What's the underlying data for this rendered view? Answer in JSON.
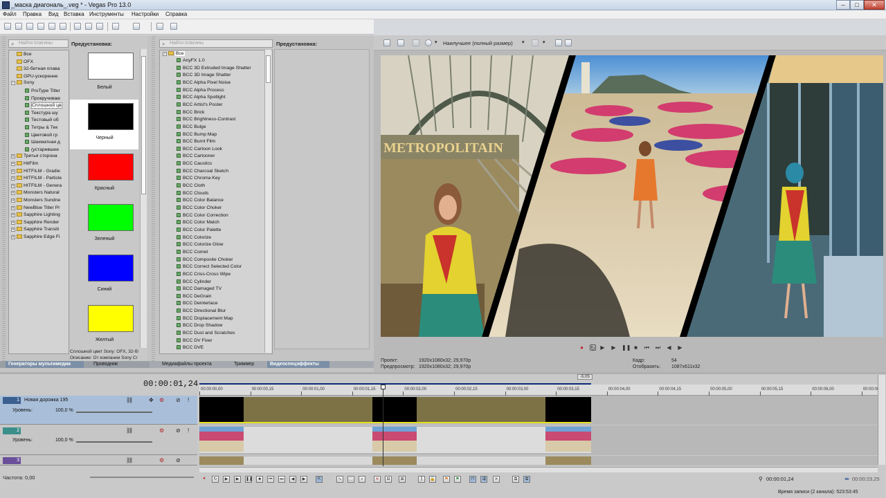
{
  "window": {
    "title": "_маска диагональ_.veg * - Vegas Pro 13.0",
    "min": "–",
    "max": "□",
    "close": "✕"
  },
  "menu": [
    "Файл",
    "Правка",
    "Вид",
    "Вставка",
    "Инструменты",
    "Настройки",
    "Справка"
  ],
  "media_generators": {
    "search_placeholder": "Найти плагины",
    "tree": [
      {
        "label": "Все",
        "level": 0,
        "expand": ""
      },
      {
        "label": "OFX",
        "level": 0,
        "expand": ""
      },
      {
        "label": "32-битная плава",
        "level": 0,
        "expand": ""
      },
      {
        "label": "GPU-ускорение",
        "level": 0,
        "expand": ""
      },
      {
        "label": "Sony",
        "level": 0,
        "expand": "−"
      },
      {
        "label": "ProType Titler",
        "level": 1,
        "expand": ""
      },
      {
        "label": "Прокручиваю",
        "level": 1,
        "expand": ""
      },
      {
        "label": "Сплошной цв",
        "level": 1,
        "expand": "",
        "selected": true
      },
      {
        "label": "Текстура шу",
        "level": 1,
        "expand": ""
      },
      {
        "label": "Тестовый об",
        "level": 1,
        "expand": ""
      },
      {
        "label": "Титры & Тек",
        "level": 1,
        "expand": ""
      },
      {
        "label": "Цветовой гр",
        "level": 1,
        "expand": ""
      },
      {
        "label": "Шахматная д",
        "level": 1,
        "expand": ""
      },
      {
        "label": "(устаревшее",
        "level": 1,
        "expand": ""
      },
      {
        "label": "Третья сторона",
        "level": 0,
        "expand": "+"
      },
      {
        "label": "HitFilm",
        "level": 0,
        "expand": "+"
      },
      {
        "label": "HITFILM - Gradie",
        "level": 0,
        "expand": "+"
      },
      {
        "label": "HITFILM - Particle",
        "level": 0,
        "expand": "+"
      },
      {
        "label": "HITFILM - Genera",
        "level": 0,
        "expand": "+"
      },
      {
        "label": "Monsters Natural",
        "level": 0,
        "expand": "+"
      },
      {
        "label": "Monsters Sundne",
        "level": 0,
        "expand": "+"
      },
      {
        "label": "NewBlue Titler Pr",
        "level": 0,
        "expand": "+"
      },
      {
        "label": "Sapphire Lighting",
        "level": 0,
        "expand": "+"
      },
      {
        "label": "Sapphire Render",
        "level": 0,
        "expand": "+"
      },
      {
        "label": "Sapphire Transiti",
        "level": 0,
        "expand": "+"
      },
      {
        "label": "Sapphire Edge Fi",
        "level": 0,
        "expand": "+"
      }
    ],
    "preset_header": "Предустановка:",
    "presets": [
      {
        "label": "Белый",
        "color": "#ffffff"
      },
      {
        "label": "Черный",
        "color": "#000000"
      },
      {
        "label": "Красный",
        "color": "#ff0000"
      },
      {
        "label": "Зеленый",
        "color": "#00ff00"
      },
      {
        "label": "Синий",
        "color": "#0000ff"
      },
      {
        "label": "Желтый",
        "color": "#ffff00"
      }
    ],
    "status_line1": "Сплошной цвет Sony: OFX, 32-бі",
    "status_line2": "Описание: От компании Sony Cr",
    "tabs": [
      "Генераторы мультимедиа",
      "Проводник"
    ]
  },
  "video_fx": {
    "search_placeholder": "Найти плагины",
    "root": "Все",
    "items": [
      "AnyFX 1.0",
      "BCC 3D Extruded Image Shatter",
      "BCC 3D Image Shatter",
      "BCC Alpha Pixel Noise",
      "BCC Alpha Process",
      "BCC Alpha Spotlight",
      "BCC Artist's Poster",
      "BCC Brick",
      "BCC Brightness-Contrast",
      "BCC Bulge",
      "BCC Bump Map",
      "BCC Burnt Film",
      "BCC Cartoon Look",
      "BCC Cartooner",
      "BCC Caustics",
      "BCC Charcoal Sketch",
      "BCC Chroma Key",
      "BCC Cloth",
      "BCC Clouds",
      "BCC Color Balance",
      "BCC Color Choker",
      "BCC Color Correction",
      "BCC Color Match",
      "BCC Color Palette",
      "BCC Colorize",
      "BCC Colorize Glow",
      "BCC Comet",
      "BCC Composite Choker",
      "BCC Correct Selected Color",
      "BCC Criss-Cross Wipe",
      "BCC Cylinder",
      "BCC Damaged TV",
      "BCC DeGrain",
      "BCC Deinterlace",
      "BCC Directional Blur",
      "BCC Displacement Map",
      "BCC Drop Shadow",
      "BCC Dust and Scratches",
      "BCC DV Fixer",
      "BCC DVE"
    ],
    "preset_header": "Предустановка:",
    "tabs": [
      "Медиафайлы проекта",
      "Триммер",
      "Видеоспецэффекты"
    ]
  },
  "preview": {
    "quality": "Наилучшее (полный размер)",
    "project_label": "Проект:",
    "project_value": "1920x1080x32; 29,970p",
    "preview_label": "Предпросмотр:",
    "preview_value": "1920x1080x32; 29,970p",
    "frame_label": "Кадр:",
    "frame_value": "54",
    "display_label": "Отобразить:",
    "display_value": "1087x611x32",
    "sign_text": "METROPOLITAIN"
  },
  "timeline": {
    "timecode": "00:00:01,24",
    "marker_label": "-5.05",
    "ruler": [
      "00:00:00,00",
      "00:00:00,15",
      "00:00:01,00",
      "00:00:01,15",
      "00:00:02,00",
      "00:00:02,15",
      "00:00:03,00",
      "00:00:03,15",
      "00:00:04,00",
      "00:00:04,15",
      "00:00:05,00",
      "00:00:05,15",
      "00:00:06,00",
      "00:00:06,15"
    ],
    "tracks": [
      {
        "num": "1",
        "name": "Новая дорожка 195",
        "level_label": "Уровень:",
        "level": "100,0 %",
        "color": "#3b5f8f"
      },
      {
        "num": "2",
        "name": "",
        "level_label": "Уровень:",
        "level": "100,0 %",
        "color": "#3b8f8a"
      },
      {
        "num": "3",
        "name": "",
        "level_label": "",
        "level": "",
        "color": "#6a4f9a"
      }
    ],
    "rate_label": "Частота: 0,00",
    "cursor_time": "00:00:01,24",
    "end_time": "00:00:23,25",
    "status": "Время записи (2 канала): 523:53:45"
  }
}
